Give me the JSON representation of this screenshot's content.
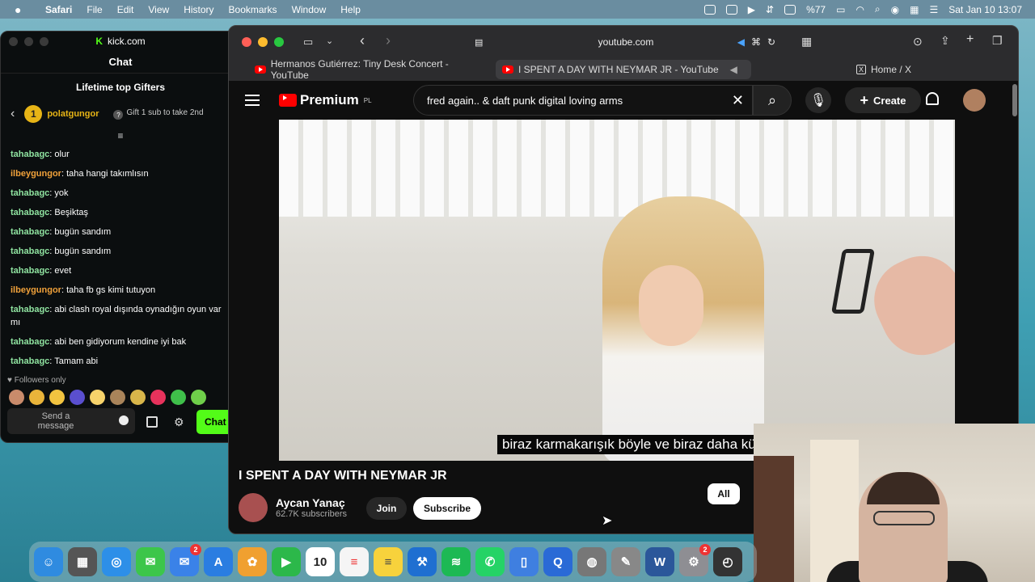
{
  "menubar": {
    "app_name": "Safari",
    "menus": [
      "File",
      "Edit",
      "View",
      "History",
      "Bookmarks",
      "Window",
      "Help"
    ],
    "battery": "%77",
    "datetime": "Sat Jan 10  13:07"
  },
  "kick": {
    "domain": "kick.com",
    "chat_title": "Chat",
    "gifters_title": "Lifetime top Gifters",
    "top_gifter": {
      "rank": "1",
      "name": "polatgungor",
      "count": "1"
    },
    "gift_prompt": "Gift 1 sub to take 2nd",
    "messages": [
      {
        "user": "tahabagc",
        "text": "olur",
        "color": "green"
      },
      {
        "user": "ilbeygungor",
        "text": "taha hangi takımlısın",
        "color": "orange"
      },
      {
        "user": "tahabagc",
        "text": "yok",
        "color": "green"
      },
      {
        "user": "tahabagc",
        "text": "Beşiktaş",
        "color": "green"
      },
      {
        "user": "tahabagc",
        "text": "bugün sandım",
        "color": "green"
      },
      {
        "user": "tahabagc",
        "text": "bugün sandım",
        "color": "green"
      },
      {
        "user": "tahabagc",
        "text": "evet",
        "color": "green"
      },
      {
        "user": "ilbeygungor",
        "text": "taha fb gs kimi tutuyon",
        "color": "orange"
      },
      {
        "user": "tahabagc",
        "text": "abi clash royal dışında oynadığın oyun var mı",
        "color": "green"
      },
      {
        "user": "tahabagc",
        "text": "abi ben gidiyorum kendine iyi bak",
        "color": "green"
      },
      {
        "user": "tahabagc",
        "text": "Tamam abi",
        "color": "green"
      }
    ],
    "followers_only": "Followers only",
    "send_placeholder": "Send a message",
    "chat_button": "Chat"
  },
  "safari": {
    "url": "youtube.com",
    "tabs": [
      {
        "title": "Hermanos Gutiérrez: Tiny Desk Concert - YouTube",
        "active": false
      },
      {
        "title": "I SPENT A DAY WITH NEYMAR JR - YouTube",
        "active": true
      },
      {
        "title": "Home / X",
        "active": false
      }
    ]
  },
  "youtube": {
    "brand": "Premium",
    "region": "PL",
    "search_value": "fred again.. & daft punk digital loving arms",
    "create_label": "Create",
    "subtitle": "biraz karmakarışık böyle ve biraz daha kü",
    "video_title": "I SPENT A DAY WITH NEYMAR JR",
    "channel_name": "Aycan Yanaç",
    "subscribers": "62.7K subscribers",
    "join_label": "Join",
    "subscribe_label": "Subscribe",
    "chip_all": "All"
  },
  "dock": {
    "calendar_day": "10",
    "badges": {
      "mail": "2",
      "settings": "2"
    }
  },
  "colors": {
    "kick_green": "#53fc18",
    "youtube_red": "#ff0000"
  }
}
